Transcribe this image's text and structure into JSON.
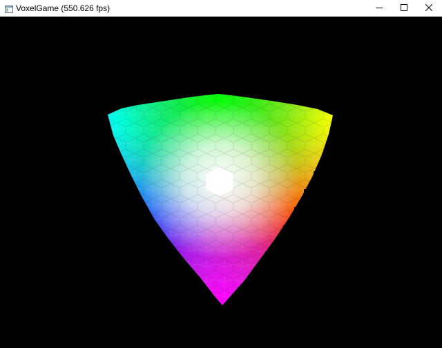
{
  "window": {
    "title": "VoxelGame (550.626 fps)",
    "icon": "app-window-icon",
    "controls": {
      "minimize_icon": "minimize-icon",
      "maximize_icon": "maximize-icon",
      "close_icon": "close-icon"
    }
  },
  "scene": {
    "background": "#000000",
    "object": "rgb-color-cube-voxels",
    "corner_colors": {
      "top_left": "#00ffff",
      "top_middle": "#00ff00",
      "top_right": "#ffff00",
      "left": "#0000ff",
      "right": "#ff0000",
      "bottom": "#ff00ff",
      "center": "#ffffff"
    }
  }
}
